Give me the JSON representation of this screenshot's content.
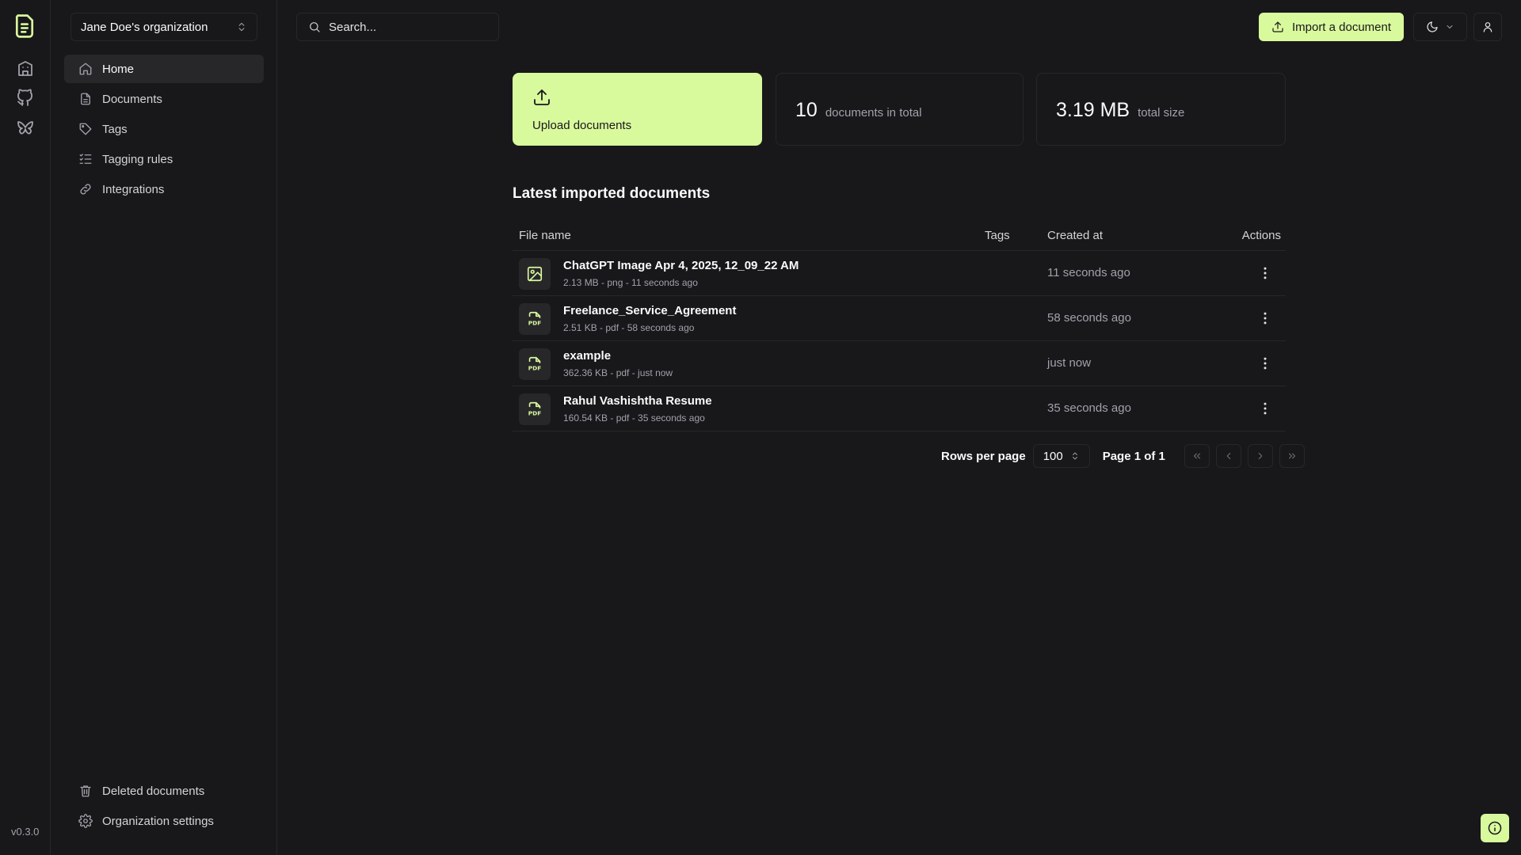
{
  "app": {
    "version": "v0.3.0",
    "accent": "#d9f99d"
  },
  "rail": {
    "items": [
      {
        "icon": "building-icon"
      },
      {
        "icon": "github-icon"
      },
      {
        "icon": "butterfly-icon"
      }
    ]
  },
  "sidebar": {
    "org_name": "Jane Doe's organization",
    "items": [
      {
        "label": "Home",
        "icon": "home-icon",
        "active": true
      },
      {
        "label": "Documents",
        "icon": "file-icon"
      },
      {
        "label": "Tags",
        "icon": "tag-icon"
      },
      {
        "label": "Tagging rules",
        "icon": "list-check-icon"
      },
      {
        "label": "Integrations",
        "icon": "link-icon"
      }
    ],
    "bottom_items": [
      {
        "label": "Deleted documents",
        "icon": "trash-icon"
      },
      {
        "label": "Organization settings",
        "icon": "gear-icon"
      }
    ]
  },
  "header": {
    "search_placeholder": "Search...",
    "import_label": "Import a document"
  },
  "stats": {
    "upload_label": "Upload documents",
    "doc_count": "10",
    "doc_count_label": "documents in total",
    "total_size": "3.19 MB",
    "total_size_label": "total size"
  },
  "latest": {
    "title": "Latest imported documents",
    "columns": {
      "file_name": "File name",
      "tags": "Tags",
      "created_at": "Created at",
      "actions": "Actions"
    },
    "rows": [
      {
        "name": "ChatGPT Image Apr 4, 2025, 12_09_22 AM",
        "meta": "2.13 MB - png - 11 seconds ago",
        "created": "11 seconds ago",
        "type": "image"
      },
      {
        "name": "Freelance_Service_Agreement",
        "meta": "2.51 KB - pdf - 58 seconds ago",
        "created": "58 seconds ago",
        "type": "pdf"
      },
      {
        "name": "example",
        "meta": "362.36 KB - pdf - just now",
        "created": "just now",
        "type": "pdf"
      },
      {
        "name": "Rahul Vashishtha Resume",
        "meta": "160.54 KB - pdf - 35 seconds ago",
        "created": "35 seconds ago",
        "type": "pdf"
      }
    ]
  },
  "pagination": {
    "rows_per_page_label": "Rows per page",
    "rows_per_page": "100",
    "page_label": "Page 1 of 1"
  }
}
